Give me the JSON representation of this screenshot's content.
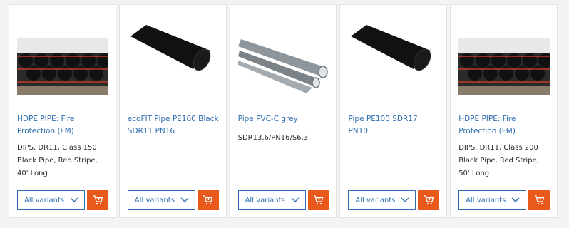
{
  "colors": {
    "link": "#2f6eb0",
    "cart_button": "#e8591b",
    "card_bg": "#ffffff",
    "page_bg": "#f3f3f3"
  },
  "products": [
    {
      "image": "hdpe-pipe-stack-photo",
      "title": "HDPE PIPE: Fire Protection (FM)",
      "description": "DIPS, DR11, Class 150 Black Pipe, Red Stripe, 40' Long",
      "variant_label": "All variants",
      "cart_icon": "add-to-cart-icon"
    },
    {
      "image": "black-pipe-photo",
      "title": "ecoFIT Pipe PE100 Black SDR11 PN16",
      "description": "",
      "variant_label": "All variants",
      "cart_icon": "add-to-cart-icon"
    },
    {
      "image": "grey-pvc-pipes-photo",
      "title": "Pipe PVC-C grey",
      "description": "SDR13,6/PN16/S6,3",
      "variant_label": "All variants",
      "cart_icon": "add-to-cart-icon"
    },
    {
      "image": "black-pipe-photo",
      "title": "Pipe PE100 SDR17 PN10",
      "description": "",
      "variant_label": "All variants",
      "cart_icon": "add-to-cart-icon"
    },
    {
      "image": "hdpe-pipe-stack-photo",
      "title": "HDPE PIPE: Fire Protection (FM)",
      "description": "DIPS, DR11, Class 200 Black Pipe, Red Stripe, 50' Long",
      "variant_label": "All variants",
      "cart_icon": "add-to-cart-icon"
    }
  ]
}
